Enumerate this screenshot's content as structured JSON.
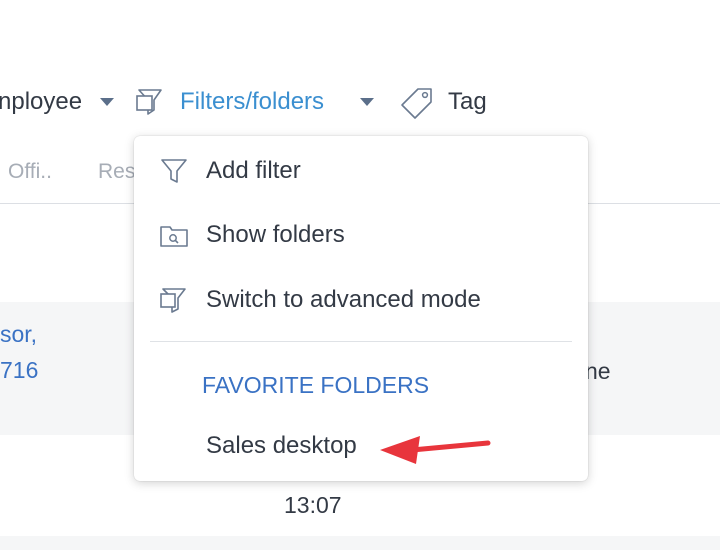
{
  "toolbar": {
    "employee_label": "nployee",
    "filters_label": "Filters/folders",
    "tag_label": "Tag"
  },
  "columns": {
    "col1": "Offi..",
    "col2": "Res"
  },
  "rows": [
    {
      "link_line1": "sor,",
      "link_line2": "716",
      "right_text": "ne"
    },
    {
      "time": "13:07"
    }
  ],
  "menu": {
    "items": [
      {
        "label": "Add filter",
        "icon": "funnel-icon"
      },
      {
        "label": "Show folders",
        "icon": "folder-search-icon"
      },
      {
        "label": "Switch to advanced mode",
        "icon": "filter-folders-icon"
      }
    ],
    "section_title": "FAVORITE FOLDERS",
    "favorites": [
      {
        "label": "Sales desktop"
      }
    ]
  },
  "colors": {
    "accent_blue": "#3b8fd0",
    "link_blue": "#3a72c4",
    "annotation_arrow": "#e8353c"
  }
}
